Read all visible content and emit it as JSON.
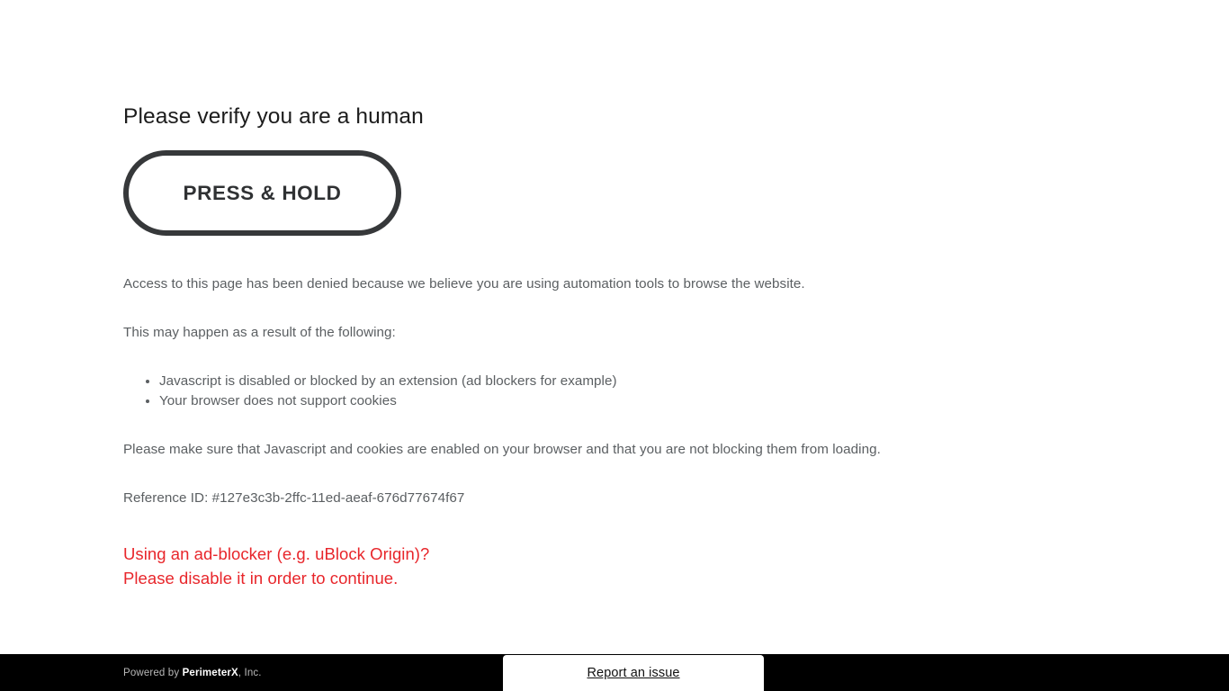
{
  "page": {
    "title": "Please verify you are a human",
    "background_color": "#ffffff"
  },
  "captcha": {
    "button_label": "PRESS & HOLD",
    "border_color": "#36383a",
    "text_color": "#2f3133"
  },
  "messages": {
    "denied": "Access to this page has been denied because we believe you are using automation tools to browse the website.",
    "reasons_intro": "This may happen as a result of the following:",
    "reasons": [
      "Javascript is disabled or blocked by an extension (ad blockers for example)",
      "Your browser does not support cookies"
    ],
    "enable_instructions": "Please make sure that Javascript and cookies are enabled on your browser and that you are not blocking them from loading.",
    "reference": "Reference ID: #127e3c3b-2ffc-11ed-aeaf-676d77674f67",
    "text_color": "#5b5f62"
  },
  "adblock_warning": {
    "line1": "Using an ad-blocker (e.g. uBlock Origin)?",
    "line2": "Please disable it in order to continue.",
    "color": "#e8262b"
  },
  "footer": {
    "credit_prefix": "Powered by ",
    "credit_brand": "PerimeterX",
    "credit_suffix": ", Inc.",
    "report_label": "Report an issue",
    "background_color": "#000000"
  }
}
